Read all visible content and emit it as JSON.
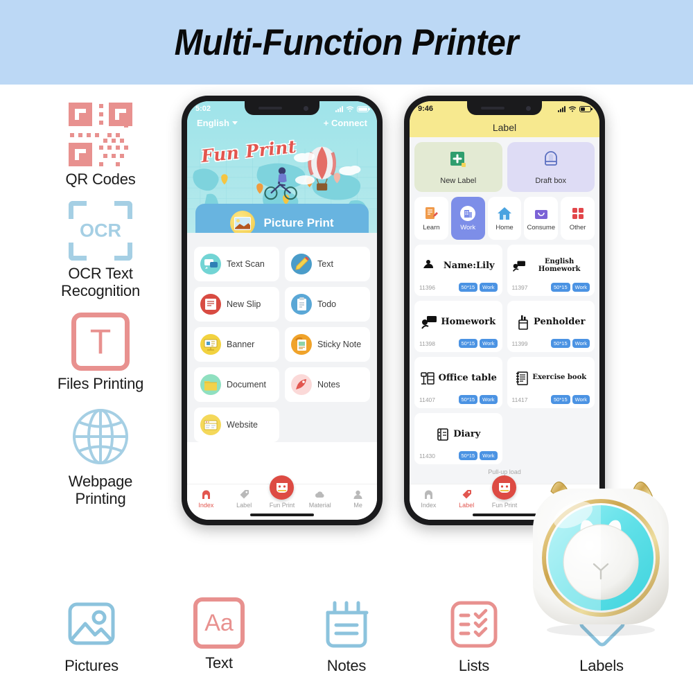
{
  "header": {
    "title": "Multi-Function Printer",
    "bg_color": "#bcd8f5"
  },
  "left_features": [
    {
      "label": "QR Codes",
      "icon": "qr-code-icon",
      "color": "#e8918f"
    },
    {
      "label": "OCR Text\nRecognition",
      "label_line1": "OCR Text",
      "label_line2": "Recognition",
      "icon": "ocr-scan-icon",
      "icon_text": "OCR",
      "color": "#a5cfe4"
    },
    {
      "label": "Files Printing",
      "icon": "text-file-icon",
      "icon_text": "T",
      "color": "#e8918f"
    },
    {
      "label": "Webpage\nPrinting",
      "label_line1": "Webpage",
      "label_line2": "Printing",
      "icon": "globe-icon",
      "color": "#a5cfe4"
    }
  ],
  "bottom_features": [
    {
      "label": "Pictures",
      "icon": "picture-icon",
      "color": "#a5cfe4"
    },
    {
      "label": "Text",
      "icon": "text-aa-icon",
      "icon_text": "Aa",
      "color": "#e8918f"
    },
    {
      "label": "Notes",
      "icon": "notes-icon",
      "color": "#a5cfe4"
    },
    {
      "label": "Lists",
      "icon": "checklist-icon",
      "color": "#e8918f"
    },
    {
      "label": "Labels",
      "icon": "tag-icon",
      "color": "#a5cfe4"
    }
  ],
  "phone1": {
    "status": {
      "time": "5:02",
      "signal": "signal-bars-icon",
      "wifi": "wifi-icon",
      "battery": "battery-icon"
    },
    "language": "English",
    "connect": "+ Connect",
    "logo": "Fun Print",
    "picture_print_button": "Picture Print",
    "tiles": [
      {
        "label": "Text Scan",
        "icon": "text-scan-icon",
        "color": "#72d4d4"
      },
      {
        "label": "Text",
        "icon": "pencil-icon",
        "color": "#4a9cc9"
      },
      {
        "label": "New Slip",
        "icon": "receipt-icon",
        "color": "#d84b42"
      },
      {
        "label": "Todo",
        "icon": "todo-icon",
        "color": "#5aa7d6"
      },
      {
        "label": "Banner",
        "icon": "banner-icon",
        "color": "#f2d23f"
      },
      {
        "label": "Sticky Note",
        "icon": "sticky-note-icon",
        "color": "#f0a32a"
      },
      {
        "label": "Document",
        "icon": "folder-icon",
        "color": "#8fe0c0"
      },
      {
        "label": "Notes",
        "icon": "rocket-icon",
        "color": "#fbd9d8"
      },
      {
        "label": "Website",
        "icon": "browser-icon",
        "color": "#f4d85a"
      }
    ],
    "tabs": [
      {
        "label": "Index",
        "icon": "home-icon",
        "active": true
      },
      {
        "label": "Label",
        "icon": "tag-icon",
        "active": false
      },
      {
        "label": "Fun Print",
        "icon": "fun-print-icon",
        "active": false,
        "center": true
      },
      {
        "label": "Material",
        "icon": "cloud-icon",
        "active": false
      },
      {
        "label": "Me",
        "icon": "user-icon",
        "active": false
      }
    ]
  },
  "phone2": {
    "status": {
      "time": "9:46"
    },
    "title": "Label",
    "cards": [
      {
        "label": "New Label",
        "icon": "new-label-icon",
        "bg": "#e3ead3",
        "color": "#2f9e6e"
      },
      {
        "label": "Draft box",
        "icon": "draft-box-icon",
        "bg": "#dedcf5",
        "color": "#5a6fc0"
      }
    ],
    "categories": [
      {
        "label": "Learn",
        "icon": "learn-icon",
        "active": false
      },
      {
        "label": "Work",
        "icon": "work-icon",
        "active": true
      },
      {
        "label": "Home",
        "icon": "home-icon",
        "active": false
      },
      {
        "label": "Consume",
        "icon": "consume-icon",
        "active": false
      },
      {
        "label": "Other",
        "icon": "grid-icon",
        "active": false
      }
    ],
    "labels": [
      {
        "name": "Name:Lily",
        "id": "11396",
        "size": "50*15",
        "tag": "Work",
        "icon": "speech-bubble-icon"
      },
      {
        "name": "English Homework",
        "id": "11397",
        "size": "50*15",
        "tag": "Work",
        "icon": "chat-icon",
        "small": true
      },
      {
        "name": "Homework",
        "id": "11398",
        "size": "50*15",
        "tag": "Work",
        "icon": "chat-icon"
      },
      {
        "name": "Penholder",
        "id": "11399",
        "size": "50*15",
        "tag": "Work",
        "icon": "penholder-icon"
      },
      {
        "name": "Office table",
        "id": "11407",
        "size": "50*15",
        "tag": "Work",
        "icon": "desk-icon"
      },
      {
        "name": "Exercise book",
        "id": "11417",
        "size": "50*15",
        "tag": "Work",
        "icon": "notebook-icon"
      },
      {
        "name": "Diary",
        "id": "11430",
        "size": "50*15",
        "tag": "Work",
        "icon": "diary-icon"
      }
    ],
    "pullup": "Pull-up load",
    "tabs": [
      {
        "label": "Index",
        "active": false
      },
      {
        "label": "Label",
        "active": true
      },
      {
        "label": "Fun Print",
        "active": false
      }
    ]
  },
  "printer": {
    "name": "cat-ear-pocket-printer",
    "body_color": "#ffffff",
    "ring_color": "#d4b25f",
    "dial_color": "#5fe0e8"
  }
}
